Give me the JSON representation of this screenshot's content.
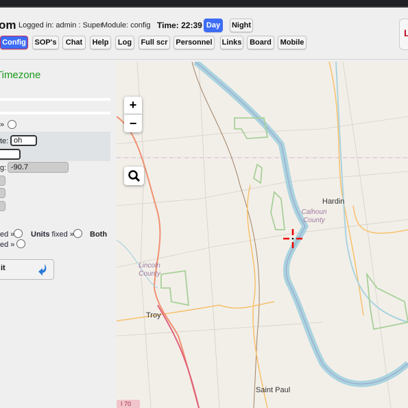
{
  "header": {
    "title_fragment": "om",
    "logged_in": "Logged in: admin : Super",
    "module": "Module: config",
    "time": "Time: 22:39",
    "day_label": "Day",
    "night_label": "Night",
    "right_fragment": "L"
  },
  "nav": [
    {
      "label": "Config",
      "active": true
    },
    {
      "label": "SOP's"
    },
    {
      "label": "Chat"
    },
    {
      "label": "Help"
    },
    {
      "label": "Log"
    },
    {
      "label": "Full scr"
    },
    {
      "label": "Personnel"
    },
    {
      "label": "Links"
    },
    {
      "label": "Board"
    },
    {
      "label": "Mobile"
    }
  ],
  "panel": {
    "heading": "Timezone",
    "radio1_label": "»",
    "state_label": "te:",
    "state_value": "oh",
    "lng_label": "g:",
    "lng_value": "-90.7",
    "fixed_label": "ed »",
    "units_fixed_strong": "Units",
    "units_fixed_rest": " fixed »",
    "both_label": "Both",
    "fixed2_label": "ed »",
    "submit_label": "it"
  },
  "map": {
    "zoom_in": "+",
    "zoom_out": "−",
    "places": [
      "Hardin",
      "Troy",
      "Saint Paul"
    ],
    "counties": [
      "Calhoun County",
      "Lincoln County"
    ],
    "shield": "I 70"
  },
  "colors": {
    "accent": "#3d6cf5",
    "heading": "#1a9a1a",
    "water": "#aad3df",
    "park": "#c8e3b0",
    "road_major": "#f09070",
    "road_minor": "#f7c06a"
  }
}
